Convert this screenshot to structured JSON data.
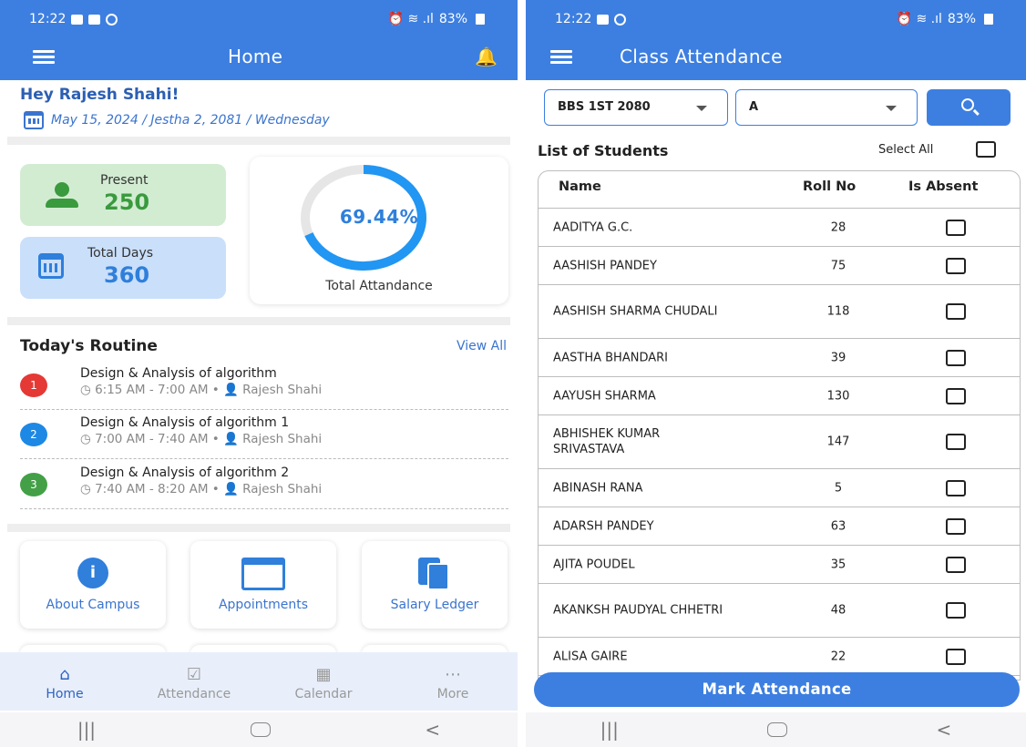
{
  "home": {
    "status_time": "12:22",
    "status_battery": "83%",
    "title": "Home",
    "greeting": "Hey Rajesh  Shahi!",
    "date_line": "May 15, 2024 / Jestha 2, 2081 / Wednesday",
    "present": {
      "label": "Present",
      "value": "250"
    },
    "total_days": {
      "label": "Total Days",
      "value": "360"
    },
    "attendance": {
      "percent": 69.44,
      "percent_text": "69.44%",
      "label": "Total Attandance"
    },
    "routine": {
      "title": "Today's Routine",
      "view_all": "View All",
      "items": [
        {
          "num": "1",
          "subject": "Design & Analysis of algorithm",
          "time": "6:15 AM - 7:00 AM",
          "teacher": "Rajesh Shahi",
          "color": "#e53935"
        },
        {
          "num": "2",
          "subject": "Design & Analysis of algorithm 1",
          "time": "7:00 AM - 7:40 AM",
          "teacher": "Rajesh Shahi",
          "color": "#1e88e5"
        },
        {
          "num": "3",
          "subject": "Design & Analysis of algorithm 2",
          "time": "7:40 AM - 8:20 AM",
          "teacher": "Rajesh Shahi",
          "color": "#43a047"
        }
      ]
    },
    "tiles": {
      "about": "About Campus",
      "appointments": "Appointments",
      "salary": "Salary Ledger"
    },
    "nav": {
      "home": "Home",
      "attendance": "Attendance",
      "calendar": "Calendar",
      "more": "More"
    }
  },
  "attendance": {
    "status_time": "12:22",
    "status_battery": "83%",
    "title": "Class Attendance",
    "class_select": "BBS 1ST 2080",
    "section_select": "A",
    "list_title": "List of Students",
    "select_all": "Select All",
    "columns": {
      "name": "Name",
      "roll": "Roll No",
      "absent": "Is Absent"
    },
    "students": [
      {
        "name": "AADITYA  G.C.",
        "roll": "28"
      },
      {
        "name": "AASHISH PANDEY",
        "roll": "75"
      },
      {
        "name": "AASHISH SHARMA CHUDALI",
        "roll": "118"
      },
      {
        "name": "AASTHA BHANDARI",
        "roll": "39"
      },
      {
        "name": "AAYUSH  SHARMA",
        "roll": "130"
      },
      {
        "name": "ABHISHEK KUMAR SRIVASTAVA",
        "roll": "147"
      },
      {
        "name": "ABINASH RANA",
        "roll": "5"
      },
      {
        "name": "ADARSH PANDEY",
        "roll": "63"
      },
      {
        "name": "AJITA  POUDEL",
        "roll": "35"
      },
      {
        "name": "AKANKSH PAUDYAL CHHETRI",
        "roll": "48"
      },
      {
        "name": "ALISA GAIRE",
        "roll": "22"
      }
    ],
    "mark_button": "Mark Attendance"
  }
}
